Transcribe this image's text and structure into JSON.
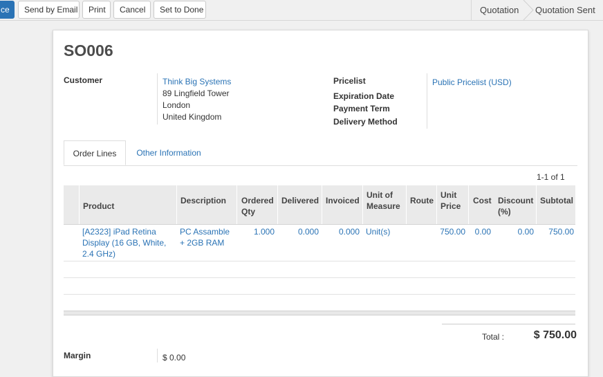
{
  "toolbar": {
    "primary_label": "ce",
    "send_email": "Send by Email",
    "print": "Print",
    "cancel": "Cancel",
    "set_done": "Set to Done"
  },
  "statusbar": {
    "step1": "Quotation",
    "step2": "Quotation Sent"
  },
  "order": {
    "name": "SO006",
    "customer_label": "Customer",
    "customer_name": "Think Big Systems",
    "address_line1": "89 Lingfield Tower",
    "address_line2": "London",
    "address_line3": "United Kingdom",
    "pricelist_label": "Pricelist",
    "pricelist_value": "Public Pricelist (USD)",
    "expiration_label": "Expiration Date",
    "payment_term_label": "Payment Term",
    "delivery_method_label": "Delivery Method"
  },
  "tabs": {
    "order_lines": "Order Lines",
    "other_info": "Other Information"
  },
  "pager": "1-1 of 1",
  "columns": {
    "product": "Product",
    "description": "Description",
    "ordered_qty": "Ordered Qty",
    "delivered": "Delivered",
    "invoiced": "Invoiced",
    "uom": "Unit of Measure",
    "route": "Route",
    "unit_price": "Unit Price",
    "cost": "Cost",
    "discount": "Discount (%)",
    "subtotal": "Subtotal"
  },
  "line": {
    "product": "[A2323] iPad Retina Display (16 GB, White, 2.4 GHz)",
    "description": "PC Assamble + 2GB RAM",
    "ordered_qty": "1.000",
    "delivered": "0.000",
    "invoiced": "0.000",
    "uom": "Unit(s)",
    "unit_price": "750.00",
    "cost": "0.00",
    "discount": "0.00",
    "subtotal": "750.00"
  },
  "totals": {
    "label": "Total :",
    "value": "$ 750.00"
  },
  "margin_label": "Margin",
  "margin_value": "$ 0.00"
}
